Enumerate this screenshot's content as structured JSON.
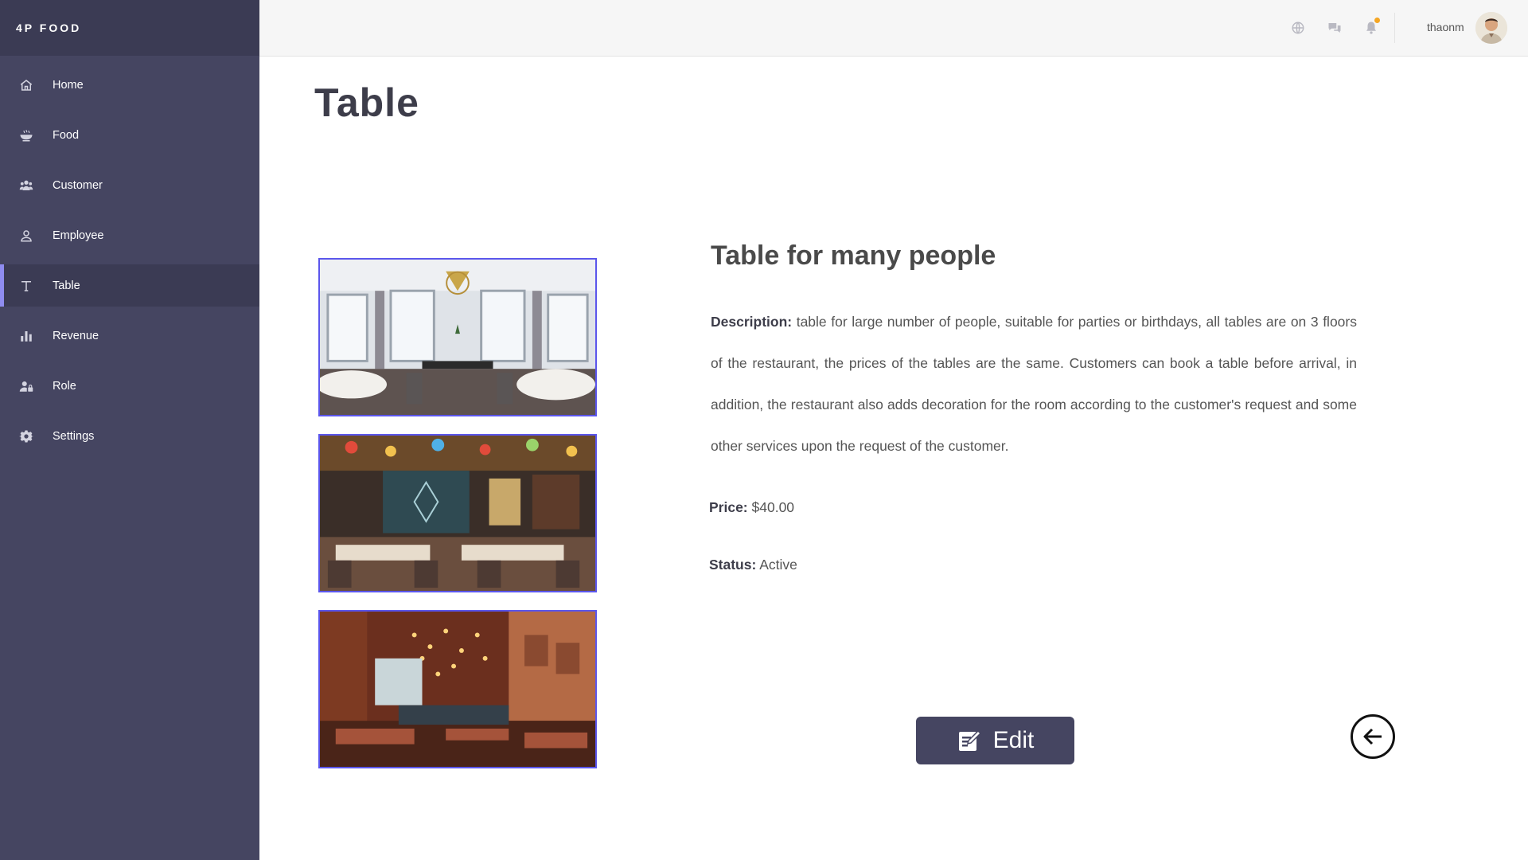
{
  "brand": "4P FOOD",
  "sidebar": {
    "items": [
      {
        "label": "Home",
        "icon": "home-icon"
      },
      {
        "label": "Food",
        "icon": "bowl-icon"
      },
      {
        "label": "Customer",
        "icon": "users-icon"
      },
      {
        "label": "Employee",
        "icon": "user-icon"
      },
      {
        "label": "Table",
        "icon": "text-t-icon",
        "active": true
      },
      {
        "label": "Revenue",
        "icon": "bar-chart-icon"
      },
      {
        "label": "Role",
        "icon": "user-lock-icon"
      },
      {
        "label": "Settings",
        "icon": "gear-icon"
      }
    ]
  },
  "topbar": {
    "username": "thaonm",
    "icons": [
      "globe-icon",
      "chat-icon",
      "bell-icon"
    ],
    "notification_dot_color": "#f5a623"
  },
  "page": {
    "title": "Table"
  },
  "detail": {
    "name": "Table for many people",
    "description_label": "Description:",
    "description": "table for large number of people, suitable for parties or birthdays, all tables are on 3 floors of the restaurant, the prices of the tables are the same. Customers can book a table before arrival, in addition, the restaurant also adds decoration for the room according to the customer's request and some other services upon the request of the customer.",
    "price_label": "Price:",
    "price": "$40.00",
    "status_label": "Status:",
    "status": "Active"
  },
  "actions": {
    "edit_label": "Edit",
    "back_icon": "arrow-left-circle-icon"
  },
  "colors": {
    "sidebar": "#454561",
    "sidebar_dark": "#3b3b54",
    "active_accent": "#8f8cf0",
    "photo_border": "#5b56ec"
  }
}
